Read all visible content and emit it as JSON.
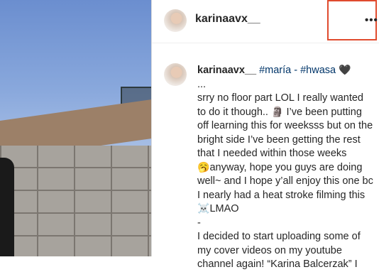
{
  "post": {
    "username": "karinaavx__",
    "more_icon": "more-horizontal-icon"
  },
  "caption": {
    "username": "karinaavx__",
    "tag1": "#maría",
    "sep": " - ",
    "tag2": "#hwasa",
    "heart": "🖤",
    "line_ellipsis": "...",
    "body1": "srry no floor part LOL I really wanted to do it though.. ",
    "emoji_moai": "🗿",
    "body2": " I’ve been putting off learning this for weeksss but on the bright side I’ve been getting the rest that I needed within those weeks",
    "emoji_yawn": "🥱",
    "body3": "anyway, hope you guys are doing well~ and I hope y’all enjoy this one bc I nearly had a heat stroke filming this ",
    "emoji_skull": "☠️",
    "body4": "LMAO",
    "dash": "-",
    "body5": "I decided to start uploading some of my cover videos on my youtube channel again! “Karina Balcerzak” I"
  }
}
